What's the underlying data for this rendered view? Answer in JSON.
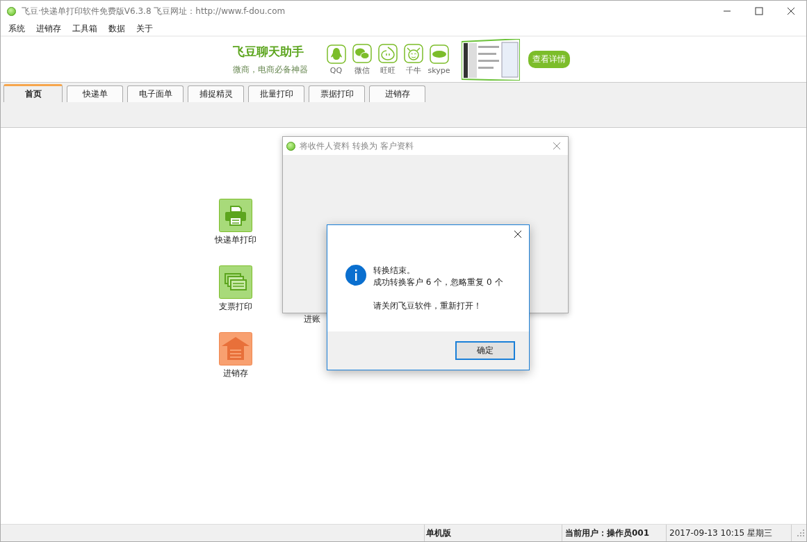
{
  "window": {
    "title": "飞豆·快递单打印软件免费版V6.3.8  飞豆网址：http://www.f-dou.com"
  },
  "menu": [
    "系统",
    "进销存",
    "工具箱",
    "数据",
    "关于"
  ],
  "banner": {
    "title": "飞豆聊天助手",
    "subtitle": "微商，电商必备神器",
    "apps": [
      {
        "kind": "qq",
        "label": "QQ"
      },
      {
        "kind": "wechat",
        "label": "微信"
      },
      {
        "kind": "wangwang",
        "label": "旺旺"
      },
      {
        "kind": "qianniu",
        "label": "千牛"
      },
      {
        "kind": "skype",
        "label": "skype"
      }
    ],
    "button": "查看详情"
  },
  "tabs": [
    {
      "label": "首页",
      "selected": true
    },
    {
      "label": "快递单",
      "selected": false
    },
    {
      "label": "电子面单",
      "selected": false
    },
    {
      "label": "捕捉精灵",
      "selected": false
    },
    {
      "label": "批量打印",
      "selected": false
    },
    {
      "label": "票据打印",
      "selected": false
    },
    {
      "label": "进销存",
      "selected": false
    }
  ],
  "tiles": [
    {
      "kind": "printer",
      "label": "快递单打印"
    },
    {
      "kind": "cheque",
      "label": "支票打印"
    },
    {
      "kind": "warehouse",
      "label": "进销存"
    }
  ],
  "covered_tile_label": "进账",
  "convert_dialog": {
    "title": "将收件人资料 转换为 客户资料"
  },
  "message_box": {
    "lines": [
      "转换结束。",
      "成功转换客户 6 个，忽略重复 0 个"
    ],
    "note": "请关闭飞豆软件，重新打开！",
    "button": "确定"
  },
  "status_bar": {
    "edition": "单机版",
    "user": "当前用户：操作员001",
    "datetime": "2017-09-13 10:15 星期三"
  }
}
